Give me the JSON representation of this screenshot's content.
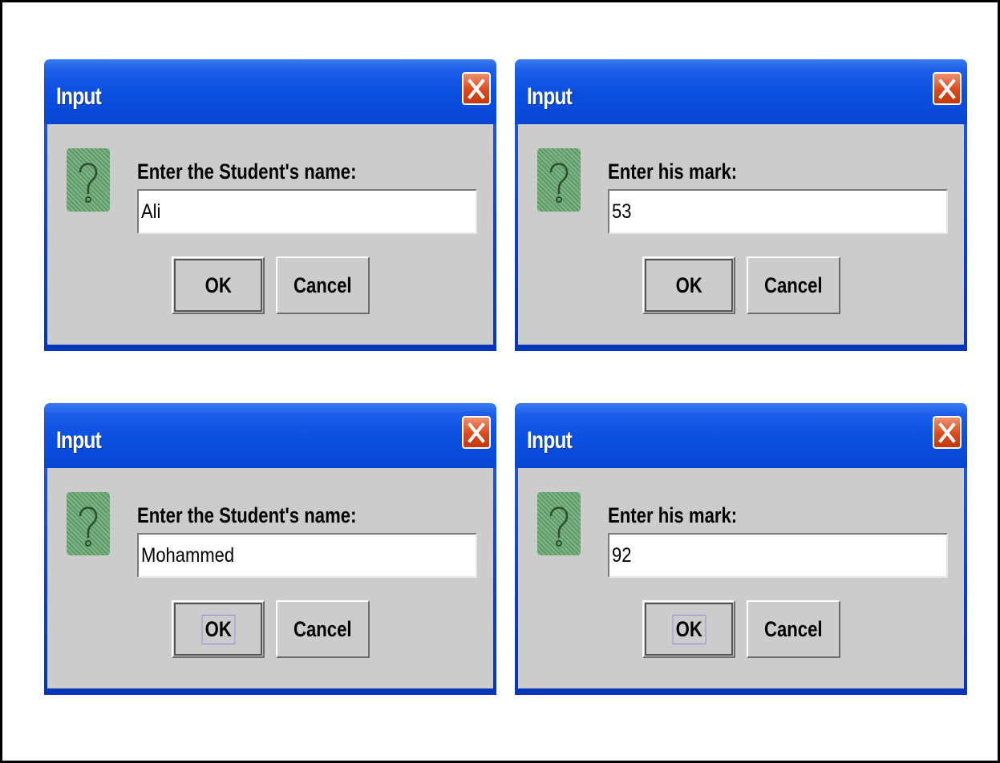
{
  "dialogs": [
    {
      "title": "Input",
      "prompt": "Enter the Student's name:",
      "value": "Ali",
      "ok_label": "OK",
      "cancel_label": "Cancel",
      "close_icon": "close-x-icon",
      "question_icon": "question-icon",
      "ok_focused": false
    },
    {
      "title": "Input",
      "prompt": "Enter his mark:",
      "value": "53",
      "ok_label": "OK",
      "cancel_label": "Cancel",
      "close_icon": "close-x-icon",
      "question_icon": "question-icon",
      "ok_focused": false
    },
    {
      "title": "Input",
      "prompt": "Enter the Student's name:",
      "value": "Mohammed",
      "ok_label": "OK",
      "cancel_label": "Cancel",
      "close_icon": "close-x-icon",
      "question_icon": "question-icon",
      "ok_focused": true
    },
    {
      "title": "Input",
      "prompt": "Enter his mark:",
      "value": "92",
      "ok_label": "OK",
      "cancel_label": "Cancel",
      "close_icon": "close-x-icon",
      "question_icon": "question-icon",
      "ok_focused": true
    }
  ],
  "colors": {
    "titlebar": "#0a4fe0",
    "body": "#cccccc",
    "close_button": "#d84a1c",
    "icon_green": "#6aa874"
  }
}
